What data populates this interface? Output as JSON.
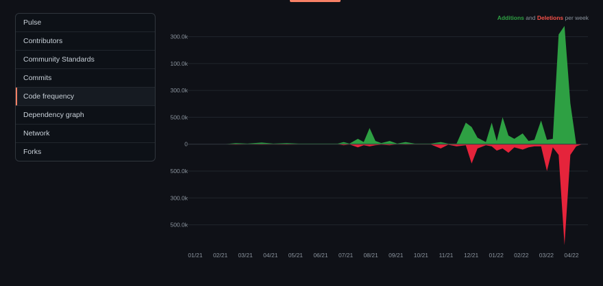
{
  "sidebar": {
    "items": [
      {
        "label": "Pulse",
        "active": false
      },
      {
        "label": "Contributors",
        "active": false
      },
      {
        "label": "Community Standards",
        "active": false
      },
      {
        "label": "Commits",
        "active": false
      },
      {
        "label": "Code frequency",
        "active": true
      },
      {
        "label": "Dependency graph",
        "active": false
      },
      {
        "label": "Network",
        "active": false
      },
      {
        "label": "Forks",
        "active": false
      }
    ]
  },
  "legend": {
    "additions": "Additions",
    "and": "and",
    "deletions": "Deletions",
    "suffix": "per week"
  },
  "colors": {
    "additions": "#2ea043",
    "deletions": "#e5243b",
    "accent": "#f78166"
  },
  "chart_data": {
    "type": "area",
    "xlabel": "",
    "ylabel": "",
    "grid": true,
    "legend_position": "top-right",
    "x_tick_labels": [
      "01/21",
      "02/21",
      "03/21",
      "04/21",
      "05/21",
      "06/21",
      "07/21",
      "08/21",
      "09/21",
      "10/21",
      "11/21",
      "12/21",
      "01/22",
      "02/22",
      "03/22",
      "04/22"
    ],
    "y_tick_labels": [
      "300.0k",
      "100.0k",
      "300.0k",
      "500.0k",
      "0",
      "500.0k",
      "300.0k",
      "500.0k"
    ],
    "y_tick_values": [
      100000,
      75000,
      50000,
      25000,
      0,
      -25000,
      -50000,
      -75000
    ],
    "ylim": [
      -95000,
      115000
    ],
    "series": [
      {
        "name": "Additions",
        "x": [
          "2021-01-01",
          "2021-01-15",
          "2021-02-01",
          "2021-02-15",
          "2021-03-01",
          "2021-03-15",
          "2021-04-01",
          "2021-04-15",
          "2021-05-01",
          "2021-05-15",
          "2021-06-01",
          "2021-06-15",
          "2021-07-01",
          "2021-07-08",
          "2021-07-15",
          "2021-07-25",
          "2021-08-01",
          "2021-08-08",
          "2021-08-15",
          "2021-08-22",
          "2021-09-01",
          "2021-09-10",
          "2021-09-20",
          "2021-10-01",
          "2021-10-10",
          "2021-10-20",
          "2021-11-01",
          "2021-11-10",
          "2021-11-20",
          "2021-12-01",
          "2021-12-08",
          "2021-12-15",
          "2021-12-25",
          "2022-01-01",
          "2022-01-07",
          "2022-01-14",
          "2022-01-21",
          "2022-01-28",
          "2022-02-07",
          "2022-02-14",
          "2022-02-21",
          "2022-03-01",
          "2022-03-08",
          "2022-03-15",
          "2022-03-22",
          "2022-03-29",
          "2022-04-05",
          "2022-04-12",
          "2022-04-19",
          "2022-04-26"
        ],
        "values": [
          0,
          0,
          0,
          0,
          1000,
          500,
          1500,
          500,
          1000,
          500,
          500,
          500,
          500,
          2000,
          500,
          5000,
          2000,
          15000,
          3000,
          1000,
          3000,
          500,
          2000,
          500,
          500,
          500,
          2000,
          500,
          500,
          20000,
          16000,
          6000,
          2000,
          20000,
          3000,
          25000,
          8000,
          5000,
          10000,
          3000,
          4000,
          22000,
          4000,
          5000,
          102000,
          110000,
          38000,
          0,
          0,
          0
        ]
      },
      {
        "name": "Deletions",
        "x": [
          "2021-01-01",
          "2021-01-15",
          "2021-02-01",
          "2021-02-15",
          "2021-03-01",
          "2021-03-15",
          "2021-04-01",
          "2021-04-15",
          "2021-05-01",
          "2021-05-15",
          "2021-06-01",
          "2021-06-15",
          "2021-07-01",
          "2021-07-08",
          "2021-07-15",
          "2021-07-25",
          "2021-08-01",
          "2021-08-08",
          "2021-08-15",
          "2021-08-22",
          "2021-09-01",
          "2021-09-10",
          "2021-09-20",
          "2021-10-01",
          "2021-10-10",
          "2021-10-20",
          "2021-11-01",
          "2021-11-10",
          "2021-11-20",
          "2021-12-01",
          "2021-12-08",
          "2021-12-15",
          "2021-12-25",
          "2022-01-01",
          "2022-01-07",
          "2022-01-14",
          "2022-01-21",
          "2022-01-28",
          "2022-02-07",
          "2022-02-14",
          "2022-02-21",
          "2022-03-01",
          "2022-03-08",
          "2022-03-15",
          "2022-03-22",
          "2022-03-29",
          "2022-04-05",
          "2022-04-12",
          "2022-04-19",
          "2022-04-26"
        ],
        "values": [
          0,
          0,
          0,
          0,
          -500,
          -200,
          -500,
          -300,
          -500,
          -200,
          -200,
          -200,
          -200,
          -1000,
          -300,
          -3000,
          -1000,
          -2000,
          -1000,
          -500,
          -1000,
          -200,
          -500,
          -300,
          -300,
          -300,
          -4000,
          -500,
          -2000,
          -1000,
          -18000,
          -4000,
          -1000,
          -2000,
          -6000,
          -4000,
          -8000,
          -3000,
          -5000,
          -3000,
          -2000,
          -2000,
          -25000,
          -3000,
          -10000,
          -94000,
          -10000,
          -2000,
          0,
          0
        ]
      }
    ]
  }
}
